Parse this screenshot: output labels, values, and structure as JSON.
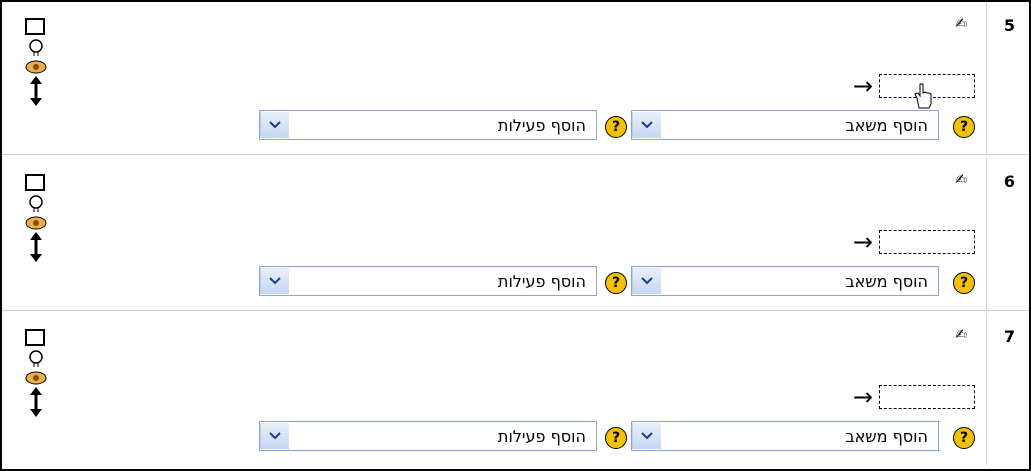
{
  "sections": [
    {
      "number": "5",
      "add_resource_label": "הוסף משאב",
      "add_activity_label": "הוסף פעילות"
    },
    {
      "number": "6",
      "add_resource_label": "הוסף משאב",
      "add_activity_label": "הוסף פעילות"
    },
    {
      "number": "7",
      "add_resource_label": "הוסף משאב",
      "add_activity_label": "הוסף פעילות"
    }
  ],
  "icons": {
    "section_icons": [
      "checkbox-icon",
      "lightbulb-icon",
      "eye-icon",
      "move-arrow-icon"
    ],
    "edit": "edit-pencil-icon",
    "arrow": "right-arrow-icon",
    "help": "help-icon",
    "dropdown": "chevron-down-icon",
    "cursor": "hand-pointer-icon"
  },
  "colors": {
    "help_bg": "#f2c200",
    "select_border": "#8aa5d8",
    "dropdown_bg": "#c6d6f2",
    "eye": "#8b4a00"
  }
}
